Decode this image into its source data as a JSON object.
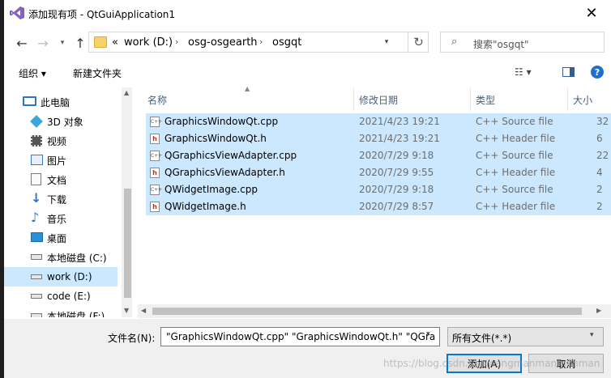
{
  "window": {
    "title": "添加现有项 - QtGuiApplication1",
    "close_glyph": "✕"
  },
  "address": {
    "overflow": "«",
    "crumbs": [
      "work (D:)",
      "osg-osgearth",
      "osgqt"
    ],
    "separator": "›",
    "dropdown_glyph": "▾",
    "refresh_glyph": "↻"
  },
  "search": {
    "placeholder": "搜索\"osgqt\"",
    "icon_glyph": "⌕"
  },
  "toolbar": {
    "organize_label": "组织 ▾",
    "new_folder_label": "新建文件夹",
    "view_label": "☷ ▾",
    "help_glyph": "?"
  },
  "nav_buttons": {
    "back": "←",
    "forward": "→",
    "recent": "▾",
    "up": "↑"
  },
  "sidebar": {
    "items": [
      {
        "label": "此电脑",
        "icon": "computer-icon",
        "color": "#2b76c9"
      },
      {
        "label": "3D 对象",
        "icon": "3d-objects-icon",
        "color": "#3aa7d8"
      },
      {
        "label": "视频",
        "icon": "video-icon",
        "color": "#555555"
      },
      {
        "label": "图片",
        "icon": "pictures-icon",
        "color": "#3a7ab8"
      },
      {
        "label": "文档",
        "icon": "documents-icon",
        "color": "#7d7d7d"
      },
      {
        "label": "下载",
        "icon": "downloads-icon",
        "color": "#2b76c9"
      },
      {
        "label": "音乐",
        "icon": "music-icon",
        "color": "#2b76c9"
      },
      {
        "label": "桌面",
        "icon": "desktop-icon",
        "color": "#2b8fd6"
      },
      {
        "label": "本地磁盘 (C:)",
        "icon": "drive-icon",
        "color": "#777777"
      },
      {
        "label": "work (D:)",
        "icon": "drive-icon",
        "color": "#777777",
        "selected": true
      },
      {
        "label": "code (E:)",
        "icon": "drive-icon",
        "color": "#777777"
      },
      {
        "label": "本地磁盘 (F:)",
        "icon": "drive-icon",
        "color": "#777777"
      }
    ]
  },
  "columns": {
    "name": "名称",
    "date": "修改日期",
    "type": "类型",
    "size": "大小"
  },
  "files": [
    {
      "name": "GraphicsWindowQt.cpp",
      "date": "2021/4/23 19:21",
      "type": "C++ Source file",
      "size": "32",
      "kind": "cpp"
    },
    {
      "name": "GraphicsWindowQt.h",
      "date": "2021/4/23 19:21",
      "type": "C++ Header file",
      "size": "6",
      "kind": "h"
    },
    {
      "name": "QGraphicsViewAdapter.cpp",
      "date": "2020/7/29 9:18",
      "type": "C++ Source file",
      "size": "22",
      "kind": "cpp"
    },
    {
      "name": "QGraphicsViewAdapter.h",
      "date": "2020/7/29 9:55",
      "type": "C++ Header file",
      "size": "4",
      "kind": "h"
    },
    {
      "name": "QWidgetImage.cpp",
      "date": "2020/7/29 9:18",
      "type": "C++ Source file",
      "size": "2",
      "kind": "cpp"
    },
    {
      "name": "QWidgetImage.h",
      "date": "2020/7/29 8:57",
      "type": "C++ Header file",
      "size": "2",
      "kind": "h"
    }
  ],
  "footer": {
    "filename_label": "文件名(N):",
    "filename_value": "\"GraphicsWindowQt.cpp\" \"GraphicsWindowQt.h\" \"QGra",
    "filter_value": "所有文件(*.*)",
    "add_label": "添加(A)",
    "cancel_label": "取消",
    "watermark": "https://blog.csdn.net/wangmanmanmanman"
  },
  "colors": {
    "selection": "#cce8ff",
    "accent": "#0078d7",
    "vs_purple": "#865fc5"
  }
}
